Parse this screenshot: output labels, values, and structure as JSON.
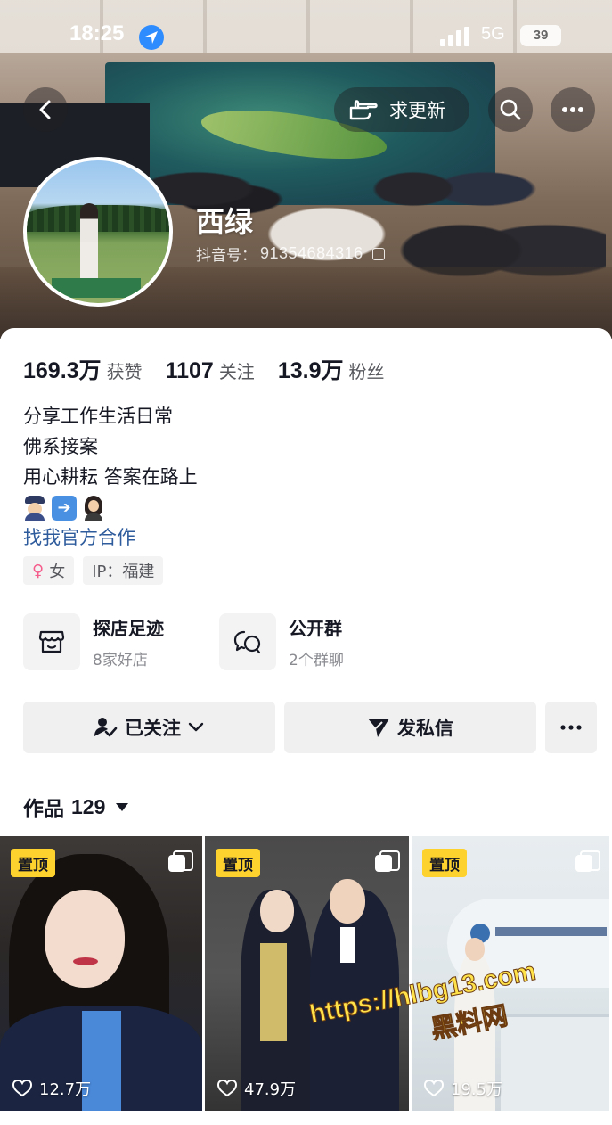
{
  "status_bar": {
    "time": "18:25",
    "network": "5G",
    "battery": "39"
  },
  "top_bar": {
    "request_update_label": "求更新"
  },
  "profile": {
    "nickname": "西绿",
    "douyin_id_label": "抖音号：",
    "douyin_id": "91354684316"
  },
  "stats": [
    {
      "value": "169.3万",
      "label": "获赞"
    },
    {
      "value": "1107",
      "label": "关注"
    },
    {
      "value": "13.9万",
      "label": "粉丝"
    }
  ],
  "bio": {
    "lines": [
      "分享工作生活日常",
      "佛系接案",
      "用心耕耘 答案在路上"
    ],
    "emoji_icons": [
      "police-officer-icon",
      "arrow-right-icon",
      "woman-technologist-icon"
    ],
    "link": "找我官方合作"
  },
  "tags": {
    "gender": "女",
    "ip": "IP：福建"
  },
  "shortcuts": [
    {
      "title": "探店足迹",
      "subtitle": "8家好店",
      "icon": "store-icon"
    },
    {
      "title": "公开群",
      "subtitle": "2个群聊",
      "icon": "chat-group-icon"
    }
  ],
  "actions": {
    "follow_label": "已关注",
    "message_label": "发私信"
  },
  "works": {
    "label": "作品",
    "count": "129"
  },
  "videos": [
    {
      "badge": "置顶",
      "likes": "12.7万"
    },
    {
      "badge": "置顶",
      "likes": "47.9万"
    },
    {
      "badge": "置顶",
      "likes": "19.5万"
    }
  ],
  "watermark": {
    "url": "https://hlbg13.com",
    "name": "黑料网"
  },
  "colors": {
    "link": "#2d5b9c",
    "pinned_badge": "#fdd12e",
    "female": "#f55d8c",
    "location_badge": "#2f8cff"
  }
}
